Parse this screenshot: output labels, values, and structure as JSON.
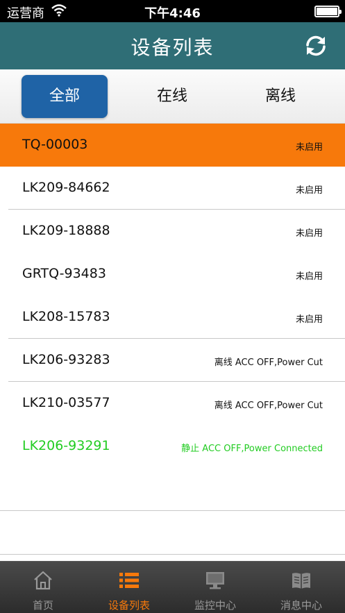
{
  "status_bar": {
    "carrier": "运营商",
    "time": "下午4:46"
  },
  "nav": {
    "title": "设备列表",
    "refresh_icon": "refresh-icon"
  },
  "segments": [
    {
      "label": "全部",
      "selected": true
    },
    {
      "label": "在线",
      "selected": false
    },
    {
      "label": "离线",
      "selected": false
    }
  ],
  "devices": [
    {
      "name": "TQ-00003",
      "status": "未启用",
      "selected": true
    },
    {
      "name": "LK209-84662",
      "status": "未启用"
    },
    {
      "name": "LK209-18888",
      "status": "未启用"
    },
    {
      "name": "GRTQ-93483",
      "status": "未启用"
    },
    {
      "name": "LK208-15783",
      "status": "未启用"
    },
    {
      "name": "LK206-93283",
      "status": "离线 ACC OFF,Power Cut"
    },
    {
      "name": "LK210-03577",
      "status": "离线 ACC OFF,Power Cut"
    },
    {
      "name": "LK206-93291",
      "status": "静止 ACC OFF,Power Connected",
      "color": "#22cc22"
    }
  ],
  "tabs": [
    {
      "label": "首页",
      "icon": "home-icon",
      "active": false
    },
    {
      "label": "设备列表",
      "icon": "list-icon",
      "active": true
    },
    {
      "label": "监控中心",
      "icon": "monitor-icon",
      "active": false
    },
    {
      "label": "消息中心",
      "icon": "book-icon",
      "active": false
    }
  ],
  "colors": {
    "nav_background": "#2f6e76",
    "segment_selected": "#1f63a6",
    "row_selected": "#f7790b",
    "status_green": "#22cc22",
    "tab_active": "#f7790b"
  }
}
